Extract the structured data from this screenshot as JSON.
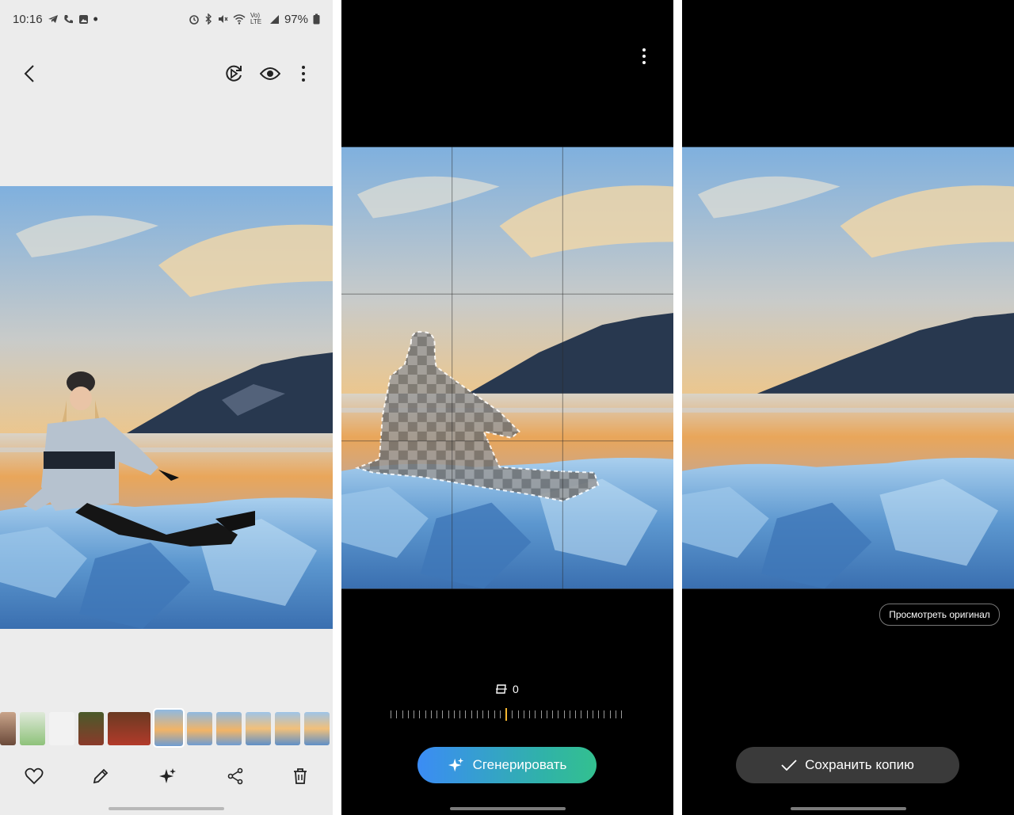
{
  "status_bar": {
    "time": "10:16",
    "battery": "97%",
    "network": "Vo) LTE"
  },
  "panel1": {
    "toolbar_icons": [
      "heart-icon",
      "pencil-icon",
      "sparkle-icon",
      "share-icon",
      "trash-icon"
    ]
  },
  "panel2": {
    "angle_value": "0",
    "generate_label": "Сгенерировать"
  },
  "panel3": {
    "view_original_label": "Просмотреть оригинал",
    "save_copy_label": "Сохранить копию"
  },
  "colors": {
    "accent_yellow": "#f5b731",
    "generate_gradient_start": "#3b8cf5",
    "generate_gradient_end": "#33c08f",
    "dark_button": "#3a3a3a"
  }
}
